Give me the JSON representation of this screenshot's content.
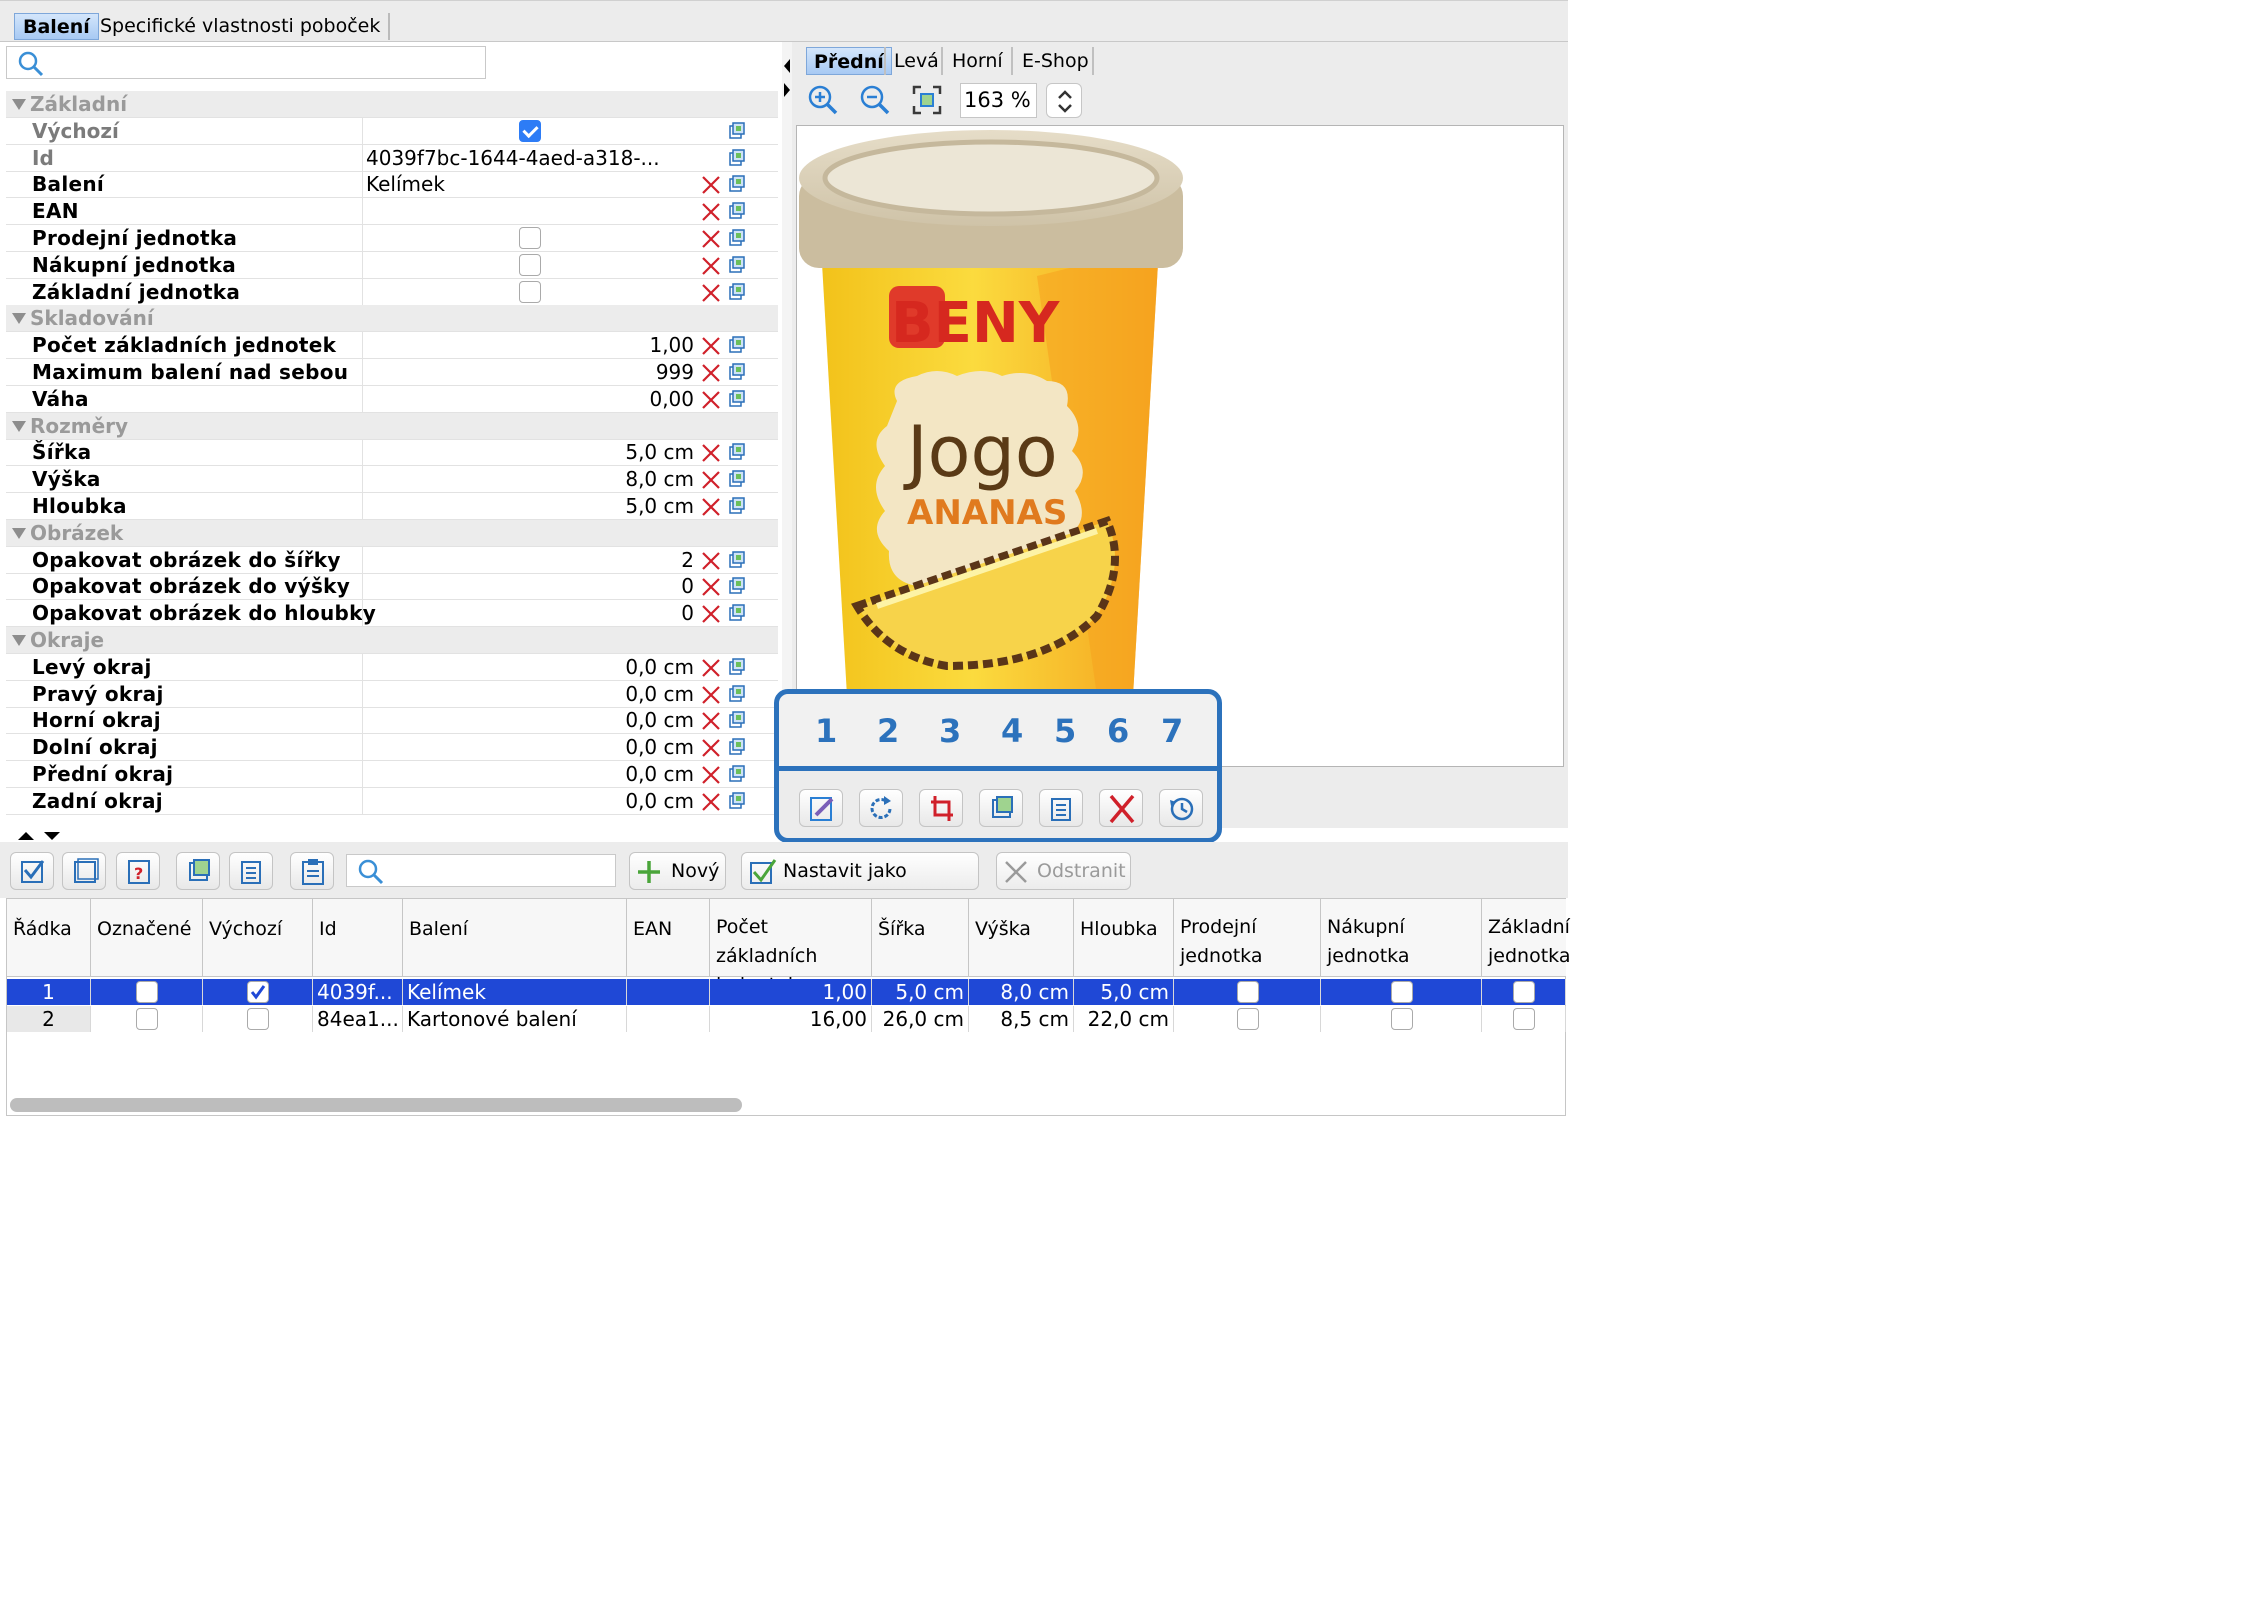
{
  "top_tabs": [
    "Balení",
    "Specifické vlastnosti poboček"
  ],
  "property_rows": [
    {
      "type": "group",
      "label": "Základní"
    },
    {
      "type": "row",
      "label": "Výchozí",
      "style": "gray",
      "check": true,
      "copy": true
    },
    {
      "type": "row",
      "label": "Id",
      "style": "gray",
      "value": "4039f7bc-1644-4aed-a318-...",
      "copy": true
    },
    {
      "type": "row",
      "label": "Balení",
      "style": "bold",
      "value": "Kelímek",
      "x": true,
      "copy": true
    },
    {
      "type": "row",
      "label": "EAN",
      "style": "bold",
      "value": "",
      "x": true,
      "copy": true
    },
    {
      "type": "row",
      "label": "Prodejní jednotka",
      "style": "bold",
      "check": false,
      "x": true,
      "copy": true
    },
    {
      "type": "row",
      "label": "Nákupní jednotka",
      "style": "bold",
      "check": false,
      "x": true,
      "copy": true
    },
    {
      "type": "row",
      "label": "Základní jednotka",
      "style": "bold",
      "check": false,
      "x": true,
      "copy": true
    },
    {
      "type": "group",
      "label": "Skladování"
    },
    {
      "type": "row",
      "label": "Počet základních jednotek",
      "style": "bold",
      "rvalue": "1,00",
      "x": true,
      "copy": true
    },
    {
      "type": "row",
      "label": "Maximum balení nad sebou",
      "style": "bold",
      "rvalue": "999",
      "x": true,
      "copy": true
    },
    {
      "type": "row",
      "label": "Váha",
      "style": "bold",
      "rvalue": "0,00",
      "x": true,
      "copy": true
    },
    {
      "type": "group",
      "label": "Rozměry"
    },
    {
      "type": "row",
      "label": "Šířka",
      "style": "bold",
      "rvalue": "5,0 cm",
      "x": true,
      "copy": true
    },
    {
      "type": "row",
      "label": "Výška",
      "style": "bold",
      "rvalue": "8,0 cm",
      "x": true,
      "copy": true
    },
    {
      "type": "row",
      "label": "Hloubka",
      "style": "bold",
      "rvalue": "5,0 cm",
      "x": true,
      "copy": true
    },
    {
      "type": "group",
      "label": "Obrázek"
    },
    {
      "type": "row",
      "label": "Opakovat obrázek do šířky",
      "style": "bold",
      "rvalue": "2",
      "x": true,
      "copy": true
    },
    {
      "type": "row",
      "label": "Opakovat obrázek do výšky",
      "style": "bold",
      "rvalue": "0",
      "x": true,
      "copy": true
    },
    {
      "type": "row",
      "label": "Opakovat obrázek do hloubky",
      "style": "bold",
      "rvalue": "0",
      "x": true,
      "copy": true
    },
    {
      "type": "group",
      "label": "Okraje"
    },
    {
      "type": "row",
      "label": "Levý okraj",
      "style": "bold",
      "rvalue": "0,0 cm",
      "x": true,
      "copy": true
    },
    {
      "type": "row",
      "label": "Pravý okraj",
      "style": "bold",
      "rvalue": "0,0 cm",
      "x": true,
      "copy": true
    },
    {
      "type": "row",
      "label": "Horní okraj",
      "style": "bold",
      "rvalue": "0,0 cm",
      "x": true,
      "copy": true
    },
    {
      "type": "row",
      "label": "Dolní okraj",
      "style": "bold",
      "rvalue": "0,0 cm",
      "x": true,
      "copy": true
    },
    {
      "type": "row",
      "label": "Přední okraj",
      "style": "bold",
      "rvalue": "0,0 cm",
      "x": true,
      "copy": true
    },
    {
      "type": "row",
      "label": "Zadní okraj",
      "style": "bold",
      "rvalue": "0,0 cm",
      "x": true,
      "copy": true
    }
  ],
  "image_tabs": [
    "Přední",
    "Levá",
    "Horní",
    "E-Shop"
  ],
  "zoom": "163 %",
  "product_image": {
    "brand": "BENY",
    "name": "Jogo",
    "flavor": "ANANAS"
  },
  "callout_numbers": [
    "1",
    "2",
    "3",
    "4",
    "5",
    "6",
    "7"
  ],
  "toolbar_buttons": {
    "new": "Nový",
    "set_default": "Nastavit jako výchozí",
    "remove": "Odstranit"
  },
  "table": {
    "headers": [
      "Řádka",
      "Označené",
      "Výchozí",
      "Id",
      "Balení",
      "EAN",
      "Počet základních jednotek",
      "Šířka",
      "Výška",
      "Hloubka",
      "Prodejní jednotka",
      "Nákupní jednotka",
      "Základní jednotka"
    ],
    "rows": [
      {
        "row": "1",
        "marked": false,
        "default": true,
        "id": "4039f...",
        "packaging": "Kelímek",
        "ean": "",
        "count": "1,00",
        "width": "5,0 cm",
        "height": "8,0 cm",
        "depth": "5,0 cm",
        "sales": false,
        "purchase": false,
        "base": false,
        "selected": true
      },
      {
        "row": "2",
        "marked": false,
        "default": false,
        "id": "84ea1...",
        "packaging": "Kartonové balení",
        "ean": "",
        "count": "16,00",
        "width": "26,0 cm",
        "height": "8,5 cm",
        "depth": "22,0 cm",
        "sales": false,
        "purchase": false,
        "base": false,
        "selected": false
      }
    ]
  },
  "colors": {
    "accent": "#2c72bc",
    "selection": "#1f48d6",
    "delete": "#d0202a"
  }
}
